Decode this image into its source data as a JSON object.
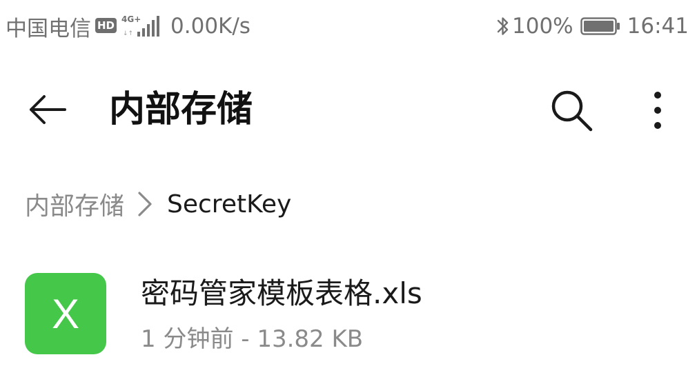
{
  "status_bar": {
    "carrier": "中国电信",
    "hd_badge": "HD",
    "network_type": "4G+",
    "net_speed": "0.00K/s",
    "bluetooth_icon": "bluetooth-icon",
    "battery_percent": "100%",
    "battery_level": 1.0,
    "time": "16:41"
  },
  "app_bar": {
    "back_icon": "arrow-left-icon",
    "title": "内部存储",
    "search_icon": "search-icon",
    "more_icon": "more-vertical-icon"
  },
  "breadcrumb": {
    "root": "内部存储",
    "separator_icon": "chevron-right-icon",
    "current": "SecretKey"
  },
  "files": [
    {
      "icon_letter": "X",
      "icon_color": "#45c84a",
      "name": "密码管家模板表格.xls",
      "meta": "1 分钟前 - 13.82 KB"
    }
  ]
}
